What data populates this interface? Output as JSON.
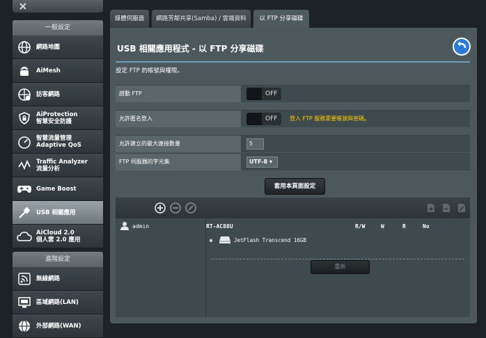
{
  "sidebar": {
    "general_header": "一般設定",
    "advanced_header": "進階設定",
    "items": [
      {
        "label": "網路地圖",
        "icon": "globe-icon"
      },
      {
        "label": "AiMesh",
        "icon": "mesh-router-icon"
      },
      {
        "label": "訪客網路",
        "icon": "guest-network-icon"
      },
      {
        "label_line1": "AiProtection",
        "label_line2": "智慧安全防護",
        "icon": "shield-lock-icon"
      },
      {
        "label_line1": "智慧流量管理",
        "label_line2": "Adaptive QoS",
        "icon": "speedometer-icon"
      },
      {
        "label_line1": "Traffic Analyzer",
        "label_line2": "流量分析",
        "icon": "traffic-icon"
      },
      {
        "label": "Game Boost",
        "icon": "gamepad-icon"
      },
      {
        "label": "USB 相關應用",
        "icon": "usb-icon"
      },
      {
        "label_line1": "AiCloud 2.0",
        "label_line2": "個人雲 2.0 應用",
        "icon": "cloud-icon"
      },
      {
        "label": "無線網路",
        "icon": "wireless-icon"
      },
      {
        "label": "區域網路(LAN)",
        "icon": "lan-icon"
      },
      {
        "label": "外部網路(WAN)",
        "icon": "wan-globe-icon"
      }
    ]
  },
  "tabs": [
    {
      "label": "媒體伺服器"
    },
    {
      "label": "網路芳鄰共享(Samba) / 雲端資料"
    },
    {
      "label": "以 FTP 分享磁碟"
    }
  ],
  "main": {
    "title": "USB 相關應用程式 - 以 FTP 分享磁碟",
    "description": "設定 FTP 的帳號與權限。",
    "settings": {
      "enable_ftp_label": "啟動 FTP",
      "enable_ftp_value": "OFF",
      "anon_label": "允許匿名登入",
      "anon_value": "OFF",
      "anon_hint": "登入 FTP 服務需要帳號與密碼。",
      "max_conn_label": "允許建立的最大連接數量",
      "max_conn_value": "5",
      "charset_label": "FTP 伺服器的字元集",
      "charset_value": "UTF-8 ▾"
    },
    "apply_label": "套用本頁面設定",
    "permissions": {
      "user": "admin",
      "device": "RT-AC88U",
      "columns": [
        "R/W",
        "W",
        "R",
        "No"
      ],
      "disk": "JetFlash Transcend 16GB",
      "rename_label": "重新"
    }
  },
  "colors": {
    "accent_blue": "#2a7bd3",
    "warning_text": "#ffcc00"
  }
}
